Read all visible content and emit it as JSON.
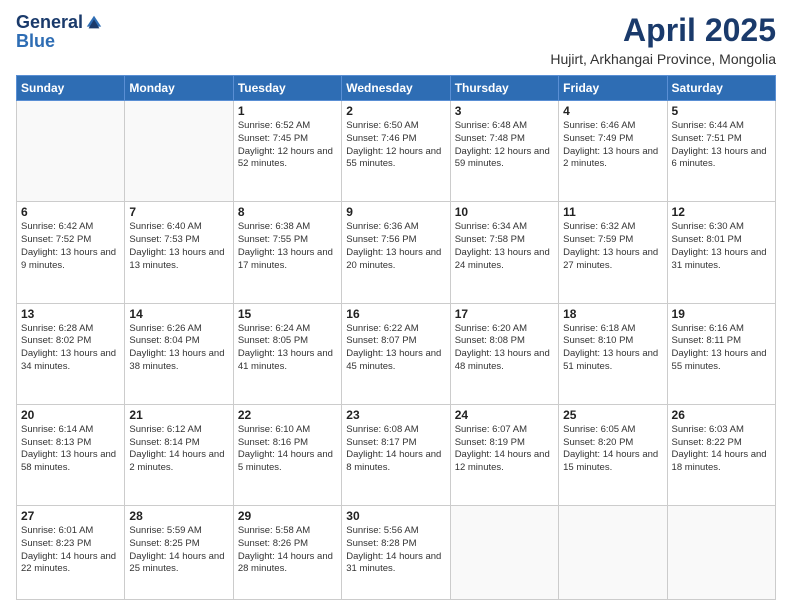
{
  "header": {
    "logo_general": "General",
    "logo_blue": "Blue",
    "title": "April 2025",
    "subtitle": "Hujirt, Arkhangai Province, Mongolia"
  },
  "weekdays": [
    "Sunday",
    "Monday",
    "Tuesday",
    "Wednesday",
    "Thursday",
    "Friday",
    "Saturday"
  ],
  "weeks": [
    [
      {
        "day": "",
        "info": ""
      },
      {
        "day": "",
        "info": ""
      },
      {
        "day": "1",
        "info": "Sunrise: 6:52 AM\nSunset: 7:45 PM\nDaylight: 12 hours and 52 minutes."
      },
      {
        "day": "2",
        "info": "Sunrise: 6:50 AM\nSunset: 7:46 PM\nDaylight: 12 hours and 55 minutes."
      },
      {
        "day": "3",
        "info": "Sunrise: 6:48 AM\nSunset: 7:48 PM\nDaylight: 12 hours and 59 minutes."
      },
      {
        "day": "4",
        "info": "Sunrise: 6:46 AM\nSunset: 7:49 PM\nDaylight: 13 hours and 2 minutes."
      },
      {
        "day": "5",
        "info": "Sunrise: 6:44 AM\nSunset: 7:51 PM\nDaylight: 13 hours and 6 minutes."
      }
    ],
    [
      {
        "day": "6",
        "info": "Sunrise: 6:42 AM\nSunset: 7:52 PM\nDaylight: 13 hours and 9 minutes."
      },
      {
        "day": "7",
        "info": "Sunrise: 6:40 AM\nSunset: 7:53 PM\nDaylight: 13 hours and 13 minutes."
      },
      {
        "day": "8",
        "info": "Sunrise: 6:38 AM\nSunset: 7:55 PM\nDaylight: 13 hours and 17 minutes."
      },
      {
        "day": "9",
        "info": "Sunrise: 6:36 AM\nSunset: 7:56 PM\nDaylight: 13 hours and 20 minutes."
      },
      {
        "day": "10",
        "info": "Sunrise: 6:34 AM\nSunset: 7:58 PM\nDaylight: 13 hours and 24 minutes."
      },
      {
        "day": "11",
        "info": "Sunrise: 6:32 AM\nSunset: 7:59 PM\nDaylight: 13 hours and 27 minutes."
      },
      {
        "day": "12",
        "info": "Sunrise: 6:30 AM\nSunset: 8:01 PM\nDaylight: 13 hours and 31 minutes."
      }
    ],
    [
      {
        "day": "13",
        "info": "Sunrise: 6:28 AM\nSunset: 8:02 PM\nDaylight: 13 hours and 34 minutes."
      },
      {
        "day": "14",
        "info": "Sunrise: 6:26 AM\nSunset: 8:04 PM\nDaylight: 13 hours and 38 minutes."
      },
      {
        "day": "15",
        "info": "Sunrise: 6:24 AM\nSunset: 8:05 PM\nDaylight: 13 hours and 41 minutes."
      },
      {
        "day": "16",
        "info": "Sunrise: 6:22 AM\nSunset: 8:07 PM\nDaylight: 13 hours and 45 minutes."
      },
      {
        "day": "17",
        "info": "Sunrise: 6:20 AM\nSunset: 8:08 PM\nDaylight: 13 hours and 48 minutes."
      },
      {
        "day": "18",
        "info": "Sunrise: 6:18 AM\nSunset: 8:10 PM\nDaylight: 13 hours and 51 minutes."
      },
      {
        "day": "19",
        "info": "Sunrise: 6:16 AM\nSunset: 8:11 PM\nDaylight: 13 hours and 55 minutes."
      }
    ],
    [
      {
        "day": "20",
        "info": "Sunrise: 6:14 AM\nSunset: 8:13 PM\nDaylight: 13 hours and 58 minutes."
      },
      {
        "day": "21",
        "info": "Sunrise: 6:12 AM\nSunset: 8:14 PM\nDaylight: 14 hours and 2 minutes."
      },
      {
        "day": "22",
        "info": "Sunrise: 6:10 AM\nSunset: 8:16 PM\nDaylight: 14 hours and 5 minutes."
      },
      {
        "day": "23",
        "info": "Sunrise: 6:08 AM\nSunset: 8:17 PM\nDaylight: 14 hours and 8 minutes."
      },
      {
        "day": "24",
        "info": "Sunrise: 6:07 AM\nSunset: 8:19 PM\nDaylight: 14 hours and 12 minutes."
      },
      {
        "day": "25",
        "info": "Sunrise: 6:05 AM\nSunset: 8:20 PM\nDaylight: 14 hours and 15 minutes."
      },
      {
        "day": "26",
        "info": "Sunrise: 6:03 AM\nSunset: 8:22 PM\nDaylight: 14 hours and 18 minutes."
      }
    ],
    [
      {
        "day": "27",
        "info": "Sunrise: 6:01 AM\nSunset: 8:23 PM\nDaylight: 14 hours and 22 minutes."
      },
      {
        "day": "28",
        "info": "Sunrise: 5:59 AM\nSunset: 8:25 PM\nDaylight: 14 hours and 25 minutes."
      },
      {
        "day": "29",
        "info": "Sunrise: 5:58 AM\nSunset: 8:26 PM\nDaylight: 14 hours and 28 minutes."
      },
      {
        "day": "30",
        "info": "Sunrise: 5:56 AM\nSunset: 8:28 PM\nDaylight: 14 hours and 31 minutes."
      },
      {
        "day": "",
        "info": ""
      },
      {
        "day": "",
        "info": ""
      },
      {
        "day": "",
        "info": ""
      }
    ]
  ]
}
